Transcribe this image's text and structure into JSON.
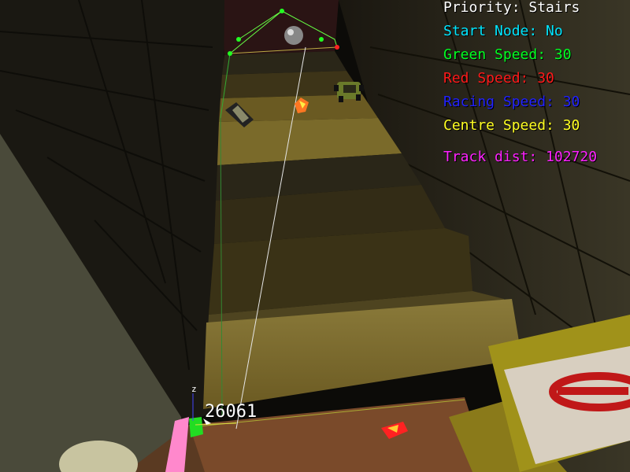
{
  "hud": {
    "priority": "Priority: Stairs",
    "start_node": "Start Node: No",
    "green_speed": "Green Speed: 30",
    "red_speed": "Red Speed: 30",
    "racing_speed": "Racing Speed: 30",
    "centre_speed": "Centre Speed: 30",
    "track_dist": "Track dist: 102720"
  },
  "node_label": "26061",
  "axis_label": "z",
  "colors": {
    "priority": "#ffffff",
    "start_node": "#00e6ff",
    "green_speed": "#00ff22",
    "red_speed": "#ff1a1a",
    "racing_speed": "#1a1aff",
    "centre_speed": "#ffff22",
    "track_dist": "#ff22ff"
  }
}
